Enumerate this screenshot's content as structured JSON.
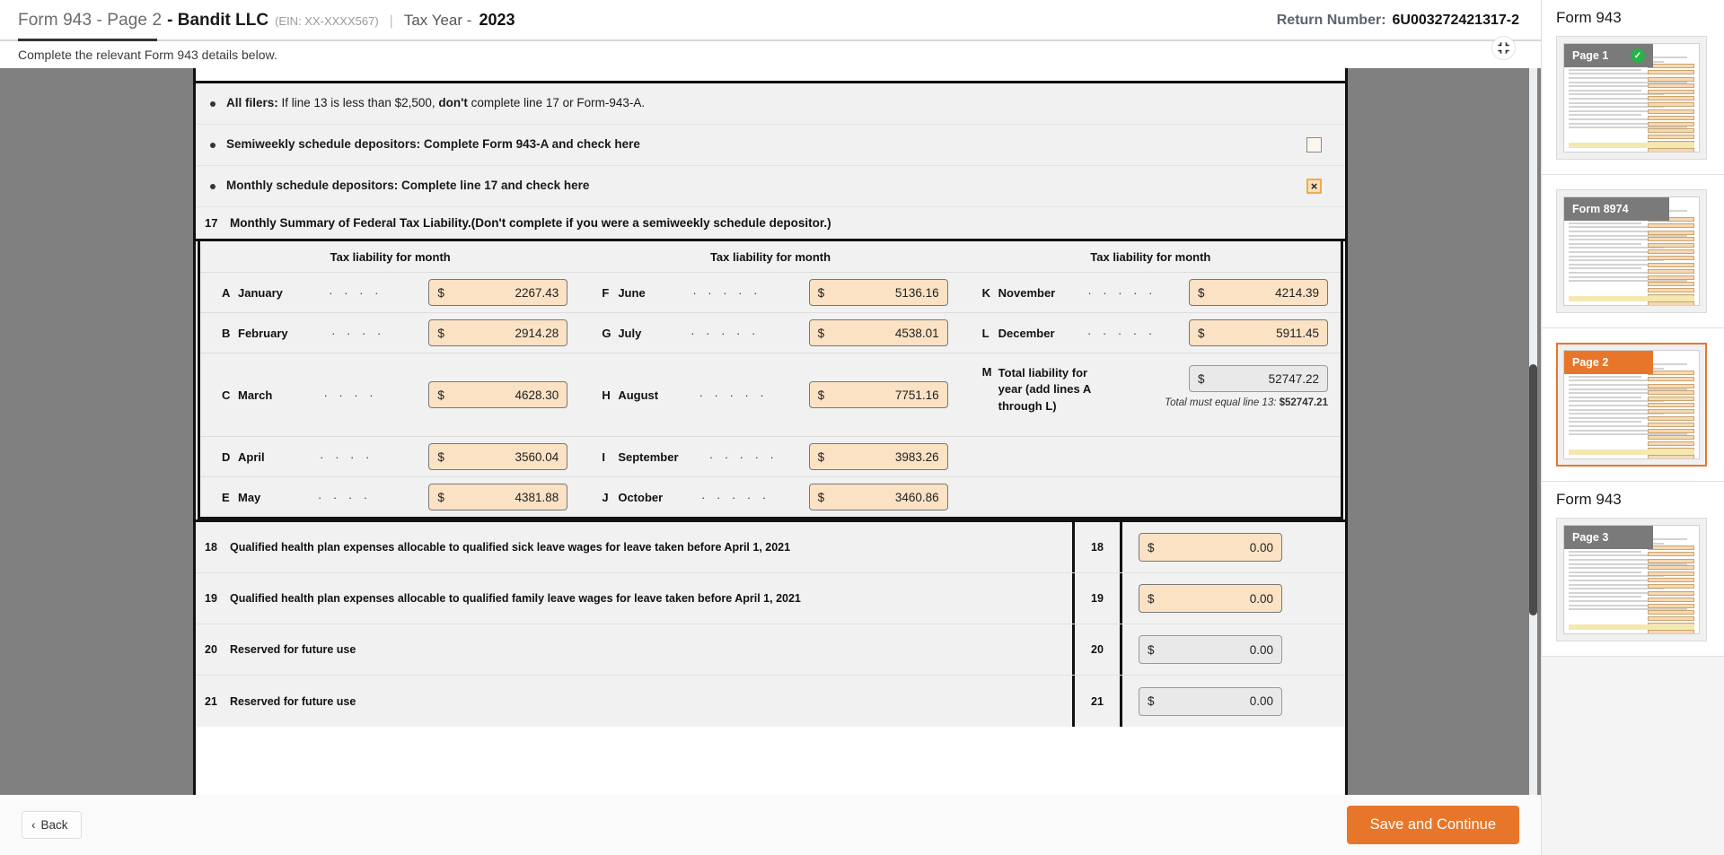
{
  "header": {
    "form_page": "Form 943 - Page 2",
    "company": "- Bandit LLC",
    "ein": "(EIN: XX-XXXX567)",
    "separator": "|",
    "tax_year_label": "Tax Year -",
    "tax_year_value": "2023",
    "return_number_label": "Return Number:",
    "return_number_value": "6U003272421317-2",
    "instruction": "Complete the relevant Form 943 details below.",
    "collapse_icon": "collapse-arrows-icon"
  },
  "bullets": [
    {
      "id": "all-filers",
      "bold": "All filers:",
      "rest_1": " If line 13 is less than $2,500, ",
      "bold_2": "don't",
      "rest_2": " complete line 17 or Form-943-A.",
      "has_checkbox": false,
      "checked": false
    },
    {
      "id": "semiweekly",
      "bold": "Semiweekly schedule depositors: Complete Form 943-A and check here",
      "rest_1": "",
      "bold_2": "",
      "rest_2": "",
      "has_checkbox": true,
      "checked": false
    },
    {
      "id": "monthly",
      "bold": "Monthly schedule depositors: Complete line 17 and check here",
      "rest_1": "",
      "bold_2": "",
      "rest_2": "",
      "has_checkbox": true,
      "checked": true,
      "check_mark": "×"
    }
  ],
  "line17": {
    "number": "17",
    "title": "Monthly Summary of Federal Tax Liability.(Don't complete if you were a semiweekly schedule depositor.)",
    "column_headers": [
      "Tax liability for month",
      "Tax liability for month",
      "Tax liability for month"
    ],
    "currency_symbol": "$",
    "dots": "· · · ·",
    "dots_long": "· · · · ·",
    "col1": [
      {
        "letter": "A",
        "month": "January",
        "value": "2267.43",
        "readonly": false
      },
      {
        "letter": "B",
        "month": "February",
        "value": "2914.28",
        "readonly": false
      },
      {
        "letter": "C",
        "month": "March",
        "value": "4628.30",
        "readonly": false
      },
      {
        "letter": "D",
        "month": "April",
        "value": "3560.04",
        "readonly": false
      },
      {
        "letter": "E",
        "month": "May",
        "value": "4381.88",
        "readonly": false
      }
    ],
    "col2": [
      {
        "letter": "F",
        "month": "June",
        "value": "5136.16",
        "readonly": false
      },
      {
        "letter": "G",
        "month": "July",
        "value": "4538.01",
        "readonly": false
      },
      {
        "letter": "H",
        "month": "August",
        "value": "7751.16",
        "readonly": false
      },
      {
        "letter": "I",
        "month": "September",
        "value": "3983.26",
        "readonly": false
      },
      {
        "letter": "J",
        "month": "October",
        "value": "3460.86",
        "readonly": false
      }
    ],
    "col3": [
      {
        "letter": "K",
        "month": "November",
        "value": "4214.39",
        "readonly": false
      },
      {
        "letter": "L",
        "month": "December",
        "value": "5911.45",
        "readonly": false
      }
    ],
    "total": {
      "letter": "M",
      "label": "Total liability for year (add lines A through L)",
      "value": "52747.22",
      "note_prefix": "Total must equal line 13: ",
      "note_amount": "$52747.21",
      "readonly": true
    }
  },
  "numbered_lines": [
    {
      "num": "18",
      "desc": "Qualified health plan expenses allocable to qualified sick leave wages for leave taken before April 1, 2021",
      "value": "0.00",
      "readonly": false
    },
    {
      "num": "19",
      "desc": "Qualified health plan expenses allocable to qualified family leave wages for leave taken before April 1, 2021",
      "value": "0.00",
      "readonly": false
    },
    {
      "num": "20",
      "desc": "Reserved for future use",
      "value": "0.00",
      "readonly": true
    },
    {
      "num": "21",
      "desc": "Reserved for future use",
      "value": "0.00",
      "readonly": true
    }
  ],
  "footer": {
    "back_label": "Back",
    "back_icon": "chevron-left-icon",
    "save_label": "Save and Continue"
  },
  "sidebar": {
    "groups": [
      {
        "title": "Form 943",
        "thumbs": [
          {
            "label": "Page 1",
            "active": false,
            "completed": true,
            "bar_style": "gray",
            "check_icon": "check-circle-icon"
          }
        ]
      },
      {
        "title": "",
        "thumbs": [
          {
            "label": "Form 8974",
            "active": false,
            "completed": false,
            "bar_style": "gray-wide"
          }
        ]
      },
      {
        "title": "",
        "thumbs": [
          {
            "label": "Page 2",
            "active": true,
            "completed": false,
            "bar_style": "orange"
          }
        ]
      },
      {
        "title": "Form 943",
        "thumbs": [
          {
            "label": "Page 3",
            "active": false,
            "completed": false,
            "bar_style": "gray"
          }
        ]
      }
    ]
  },
  "colors": {
    "accent": "#e8762a",
    "input_fill": "#fbe2c4",
    "readonly_fill": "#e9e9e9",
    "doc_backdrop": "#808080",
    "success": "#27b34a"
  }
}
